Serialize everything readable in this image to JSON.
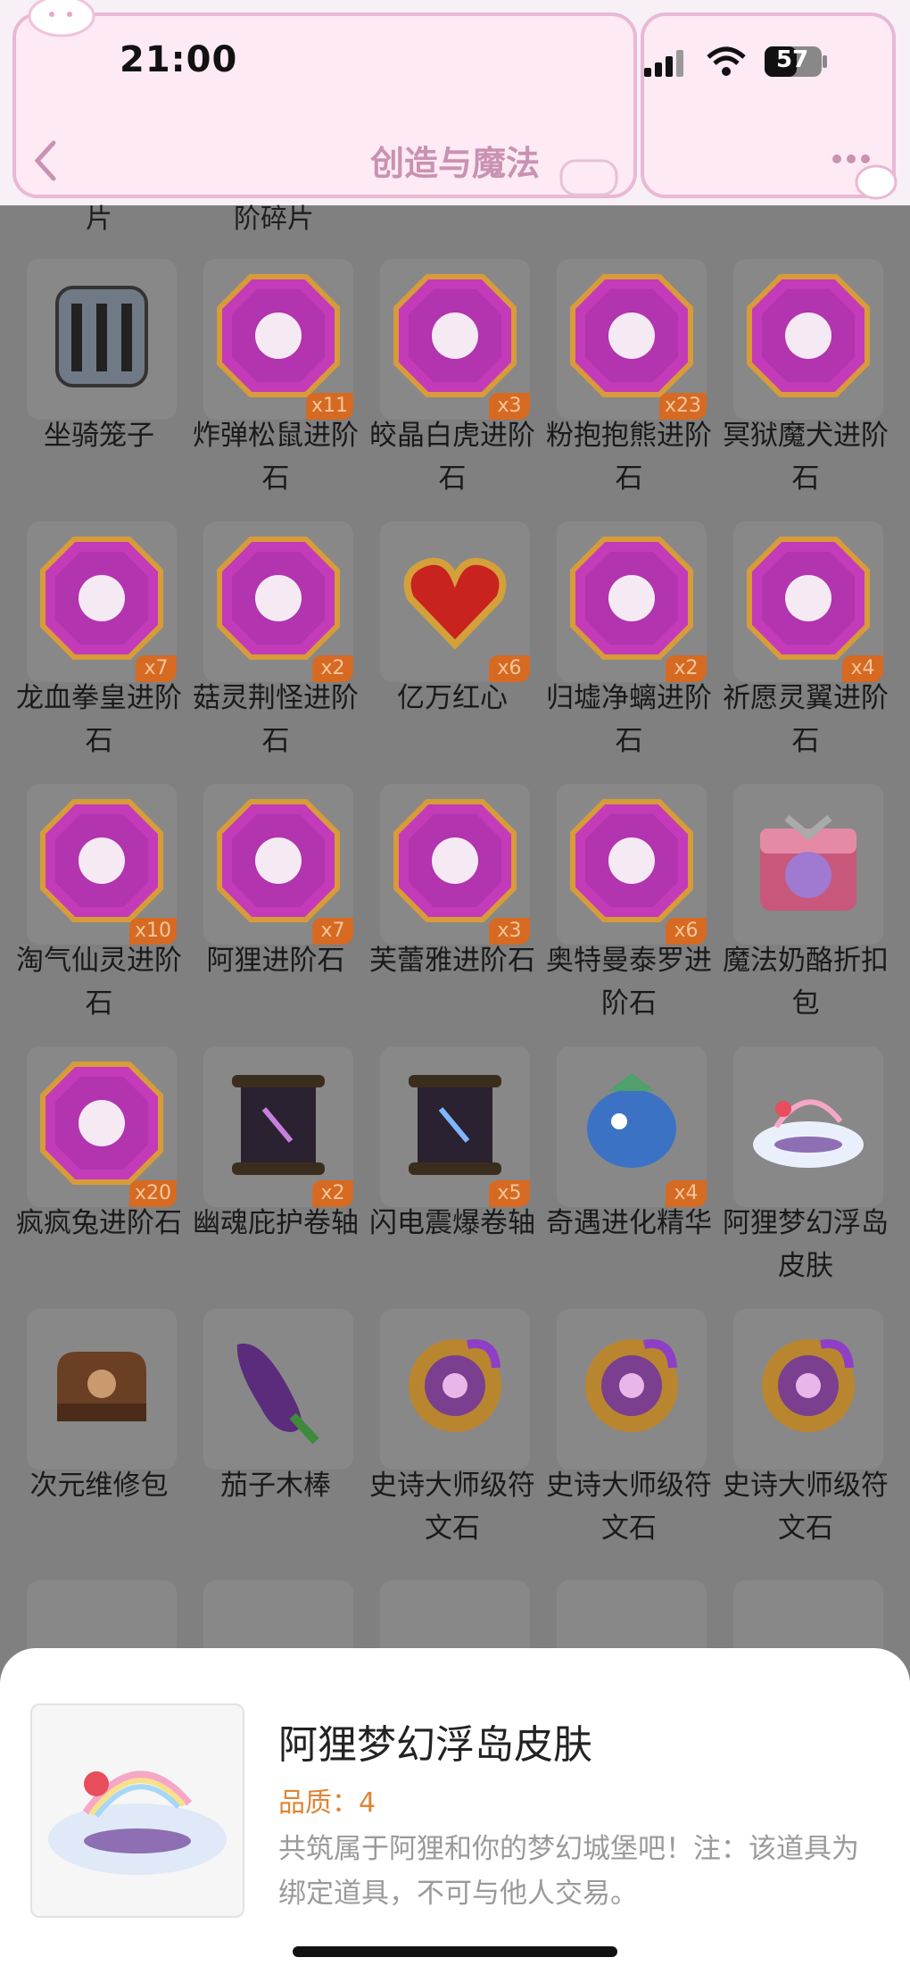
{
  "status": {
    "time": "21:00",
    "battery": "57"
  },
  "header": {
    "title": "创造与魔法"
  },
  "partial_labels": [
    "片",
    "阶碎片"
  ],
  "items": [
    {
      "label": "坐骑笼子",
      "badge": "",
      "icon": "cage",
      "color": "#2d3b55"
    },
    {
      "label": "炸弹松鼠进阶石",
      "badge": "x11",
      "icon": "acorn",
      "color": "#c33bb8"
    },
    {
      "label": "皎晶白虎进阶石",
      "badge": "x3",
      "icon": "fang",
      "color": "#c33bb8"
    },
    {
      "label": "粉抱抱熊进阶石",
      "badge": "x23",
      "icon": "egg",
      "color": "#c33bb8"
    },
    {
      "label": "冥狱魔犬进阶石",
      "badge": "",
      "icon": "swirl",
      "color": "#c33bb8"
    },
    {
      "label": "龙血拳皇进阶石",
      "badge": "x7",
      "icon": "bull",
      "color": "#c33bb8"
    },
    {
      "label": "菇灵荆怪进阶石",
      "badge": "x2",
      "icon": "mushroom",
      "color": "#c33bb8"
    },
    {
      "label": "亿万红心",
      "badge": "x6",
      "icon": "heart",
      "color": "#c8231f"
    },
    {
      "label": "归墟净螭进阶石",
      "badge": "x2",
      "icon": "dragon",
      "color": "#c33bb8"
    },
    {
      "label": "祈愿灵翼进阶石",
      "badge": "x4",
      "icon": "wing",
      "color": "#c33bb8"
    },
    {
      "label": "淘气仙灵进阶石",
      "badge": "x10",
      "icon": "fairy",
      "color": "#c33bb8"
    },
    {
      "label": "阿狸进阶石",
      "badge": "x7",
      "icon": "fox",
      "color": "#c33bb8"
    },
    {
      "label": "芙蕾雅进阶石",
      "badge": "x3",
      "icon": "flame",
      "color": "#c33bb8"
    },
    {
      "label": "奥特曼泰罗进阶石",
      "badge": "x6",
      "icon": "mask",
      "color": "#c33bb8"
    },
    {
      "label": "魔法奶酪折扣包",
      "badge": "",
      "icon": "giftbox",
      "color": "#c8577c"
    },
    {
      "label": "疯疯兔进阶石",
      "badge": "x20",
      "icon": "carrot",
      "color": "#c33bb8"
    },
    {
      "label": "幽魂庇护卷轴",
      "badge": "x2",
      "icon": "scroll",
      "color": "#2a2230"
    },
    {
      "label": "闪电震爆卷轴",
      "badge": "x5",
      "icon": "scroll2",
      "color": "#2a2230"
    },
    {
      "label": "奇遇进化精华",
      "badge": "x4",
      "icon": "essence",
      "color": "#3c72c4"
    },
    {
      "label": "阿狸梦幻浮岛皮肤",
      "badge": "",
      "icon": "island",
      "color": "#c9c7e8"
    },
    {
      "label": "次元维修包",
      "badge": "",
      "icon": "bag",
      "color": "#6a3f23"
    },
    {
      "label": "茄子木棒",
      "badge": "",
      "icon": "eggplant",
      "color": "#5b2b7c"
    },
    {
      "label": "史诗大师级符文石",
      "badge": "",
      "icon": "rune",
      "color": "#b9862f"
    },
    {
      "label": "史诗大师级符文石",
      "badge": "",
      "icon": "rune",
      "color": "#b9862f"
    },
    {
      "label": "史诗大师级符文石",
      "badge": "",
      "icon": "rune",
      "color": "#b9862f"
    }
  ],
  "detail": {
    "name": "阿狸梦幻浮岛皮肤",
    "quality": "品质：4",
    "description": "共筑属于阿狸和你的梦幻城堡吧！注：该道具为绑定道具，不可与他人交易。"
  }
}
